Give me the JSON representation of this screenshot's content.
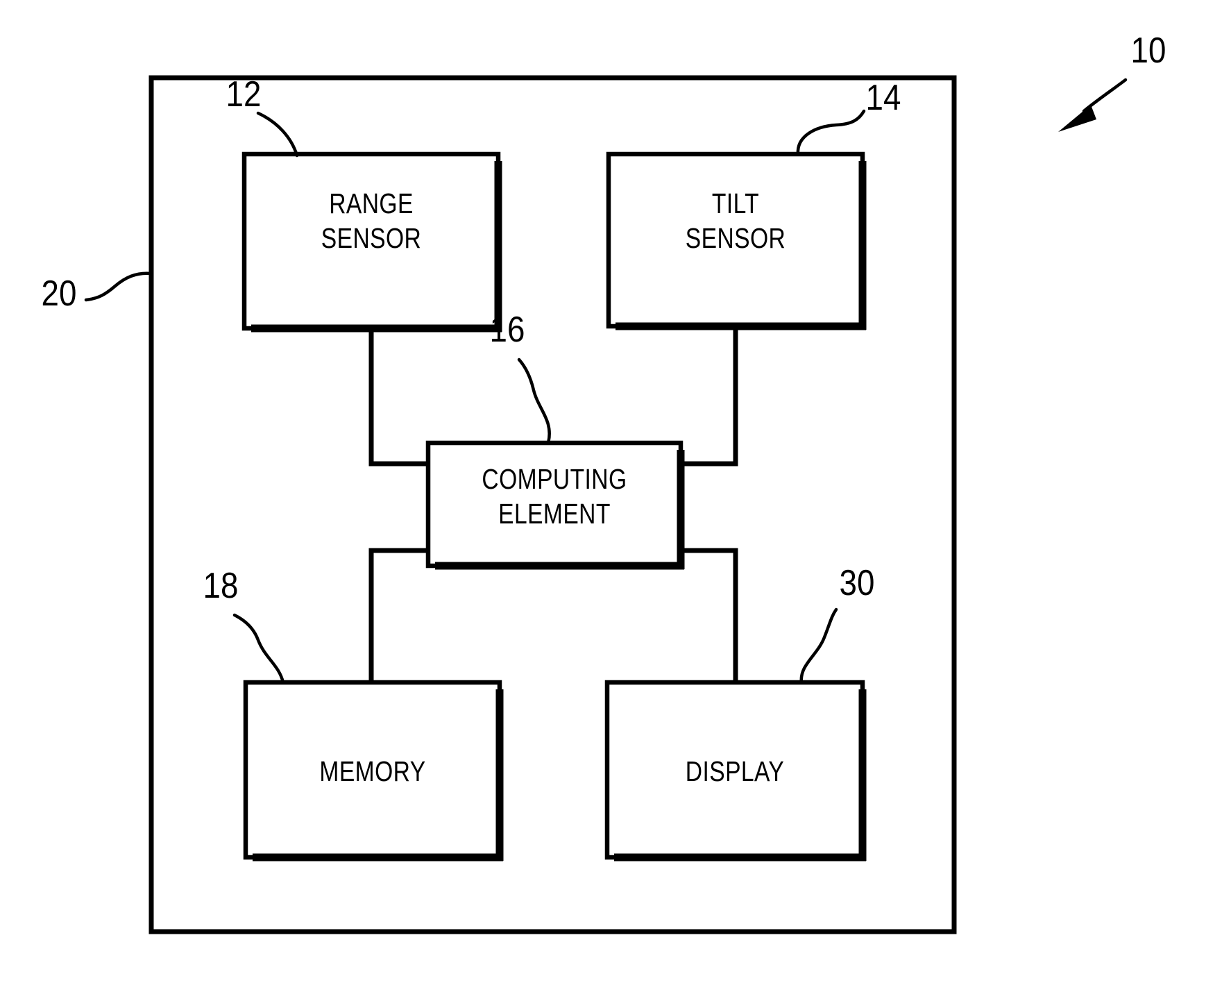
{
  "figure": {
    "title": "System block diagram",
    "background_color": "#ffffff",
    "line_color": "#000000"
  },
  "system": {
    "reference_numeral": "10",
    "enclosure_reference_numeral": "20"
  },
  "blocks": [
    {
      "id": "range-sensor",
      "label_line1": "RANGE",
      "label_line2": "SENSOR",
      "reference_numeral": "12"
    },
    {
      "id": "tilt-sensor",
      "label_line1": "TILT",
      "label_line2": "SENSOR",
      "reference_numeral": "14"
    },
    {
      "id": "computing-element",
      "label_line1": "COMPUTING",
      "label_line2": "ELEMENT",
      "reference_numeral": "16"
    },
    {
      "id": "memory",
      "label_line1": "MEMORY",
      "label_line2": "",
      "reference_numeral": "18"
    },
    {
      "id": "display",
      "label_line1": "DISPLAY",
      "label_line2": "",
      "reference_numeral": "30"
    }
  ],
  "connections": [
    {
      "from": "range-sensor",
      "to": "computing-element"
    },
    {
      "from": "tilt-sensor",
      "to": "computing-element"
    },
    {
      "from": "computing-element",
      "to": "memory"
    },
    {
      "from": "computing-element",
      "to": "display"
    }
  ]
}
